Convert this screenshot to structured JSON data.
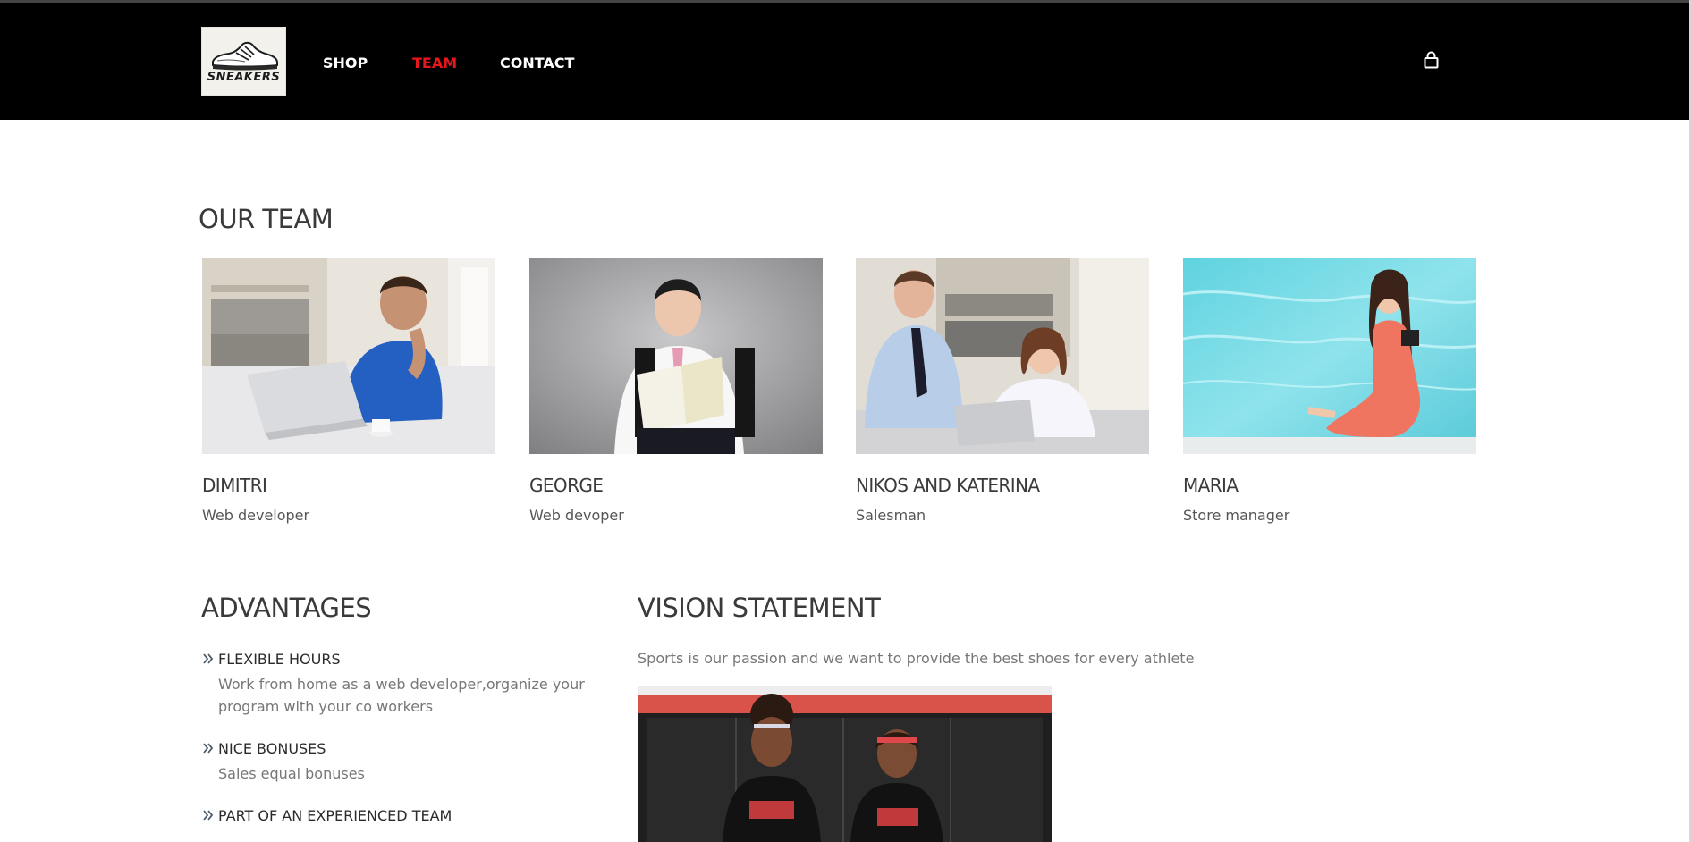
{
  "header": {
    "logo_text": "SNEAKERS",
    "nav": [
      {
        "label": "SHOP"
      },
      {
        "label": "TEAM",
        "active": true
      },
      {
        "label": "CONTACT"
      }
    ],
    "active_color": "#e8171c",
    "cart_icon": "shopping-bag-icon"
  },
  "team_section": {
    "heading": "OUR TEAM",
    "members": [
      {
        "name": "DIMITRI",
        "role": "Web developer"
      },
      {
        "name": "GEORGE",
        "role": "Web devoper"
      },
      {
        "name": "NIKOS AND KATERINA",
        "role": "Salesman"
      },
      {
        "name": "MARIA",
        "role": "Store manager"
      }
    ]
  },
  "advantages": {
    "heading": "ADVANTAGES",
    "items": [
      {
        "title": "FLEXIBLE HOURS",
        "text": "Work from home as a web developer,organize your program with your co workers"
      },
      {
        "title": "NICE BONUSES",
        "text": "Sales equal bonuses"
      },
      {
        "title": "PART OF AN EXPERIENCED TEAM",
        "text": ""
      }
    ],
    "bullet_icon": "double-chevron-right-icon"
  },
  "vision": {
    "heading": "VISION STATEMENT",
    "text": "Sports is our passion and we want to provide the best shoes for every athlete"
  }
}
